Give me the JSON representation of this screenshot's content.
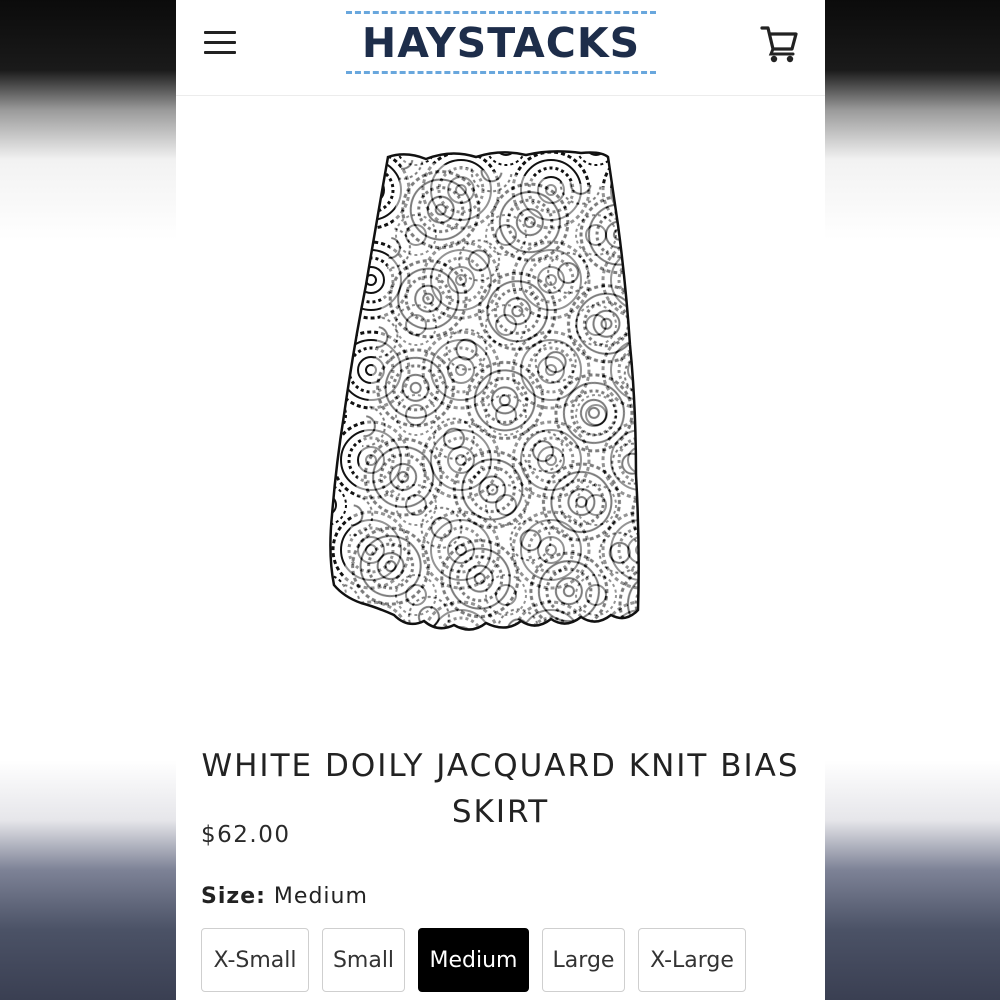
{
  "brand": {
    "name": "HAYSTACKS",
    "accent_color": "#69a7dd",
    "text_color": "#1d2d4a"
  },
  "header": {
    "menu_icon": "hamburger-menu-icon",
    "cart_icon": "shopping-cart-icon"
  },
  "product": {
    "title": "WHITE DOILY JACQUARD KNIT BIAS SKIRT",
    "price": "$62.00",
    "image": "white-doily-skirt-image"
  },
  "size": {
    "label": "Size:",
    "selected": "Medium",
    "options": [
      "X-Small",
      "Small",
      "Medium",
      "Large",
      "X-Large"
    ]
  }
}
